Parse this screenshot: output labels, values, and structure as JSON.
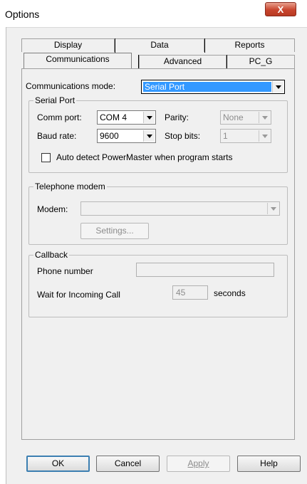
{
  "window": {
    "title": "Options",
    "close_label": "X"
  },
  "tabs": {
    "row_back": [
      "Display",
      "Data",
      "Reports"
    ],
    "row_front": [
      "Communications",
      "Advanced",
      "PC_G"
    ],
    "active": "Communications"
  },
  "comm": {
    "mode_label": "Communications mode:",
    "mode_value": "Serial Port"
  },
  "serial": {
    "title": "Serial Port",
    "comm_port_label": "Comm port:",
    "comm_port_value": "COM 4",
    "parity_label": "Parity:",
    "parity_value": "None",
    "baud_rate_label": "Baud rate:",
    "baud_rate_value": "9600",
    "stop_bits_label": "Stop bits:",
    "stop_bits_value": "1",
    "auto_detect_label": "Auto detect PowerMaster when program starts",
    "auto_detect_checked": false
  },
  "telephone": {
    "title": "Telephone modem",
    "modem_label": "Modem:",
    "modem_value": "",
    "settings_button": "Settings..."
  },
  "callback": {
    "title": "Callback",
    "phone_label": "Phone number",
    "phone_value": "",
    "wait_label": "Wait for Incoming Call",
    "wait_value": "45",
    "seconds_label": "seconds"
  },
  "buttons": {
    "ok": "OK",
    "cancel": "Cancel",
    "apply": "Apply",
    "help": "Help"
  }
}
